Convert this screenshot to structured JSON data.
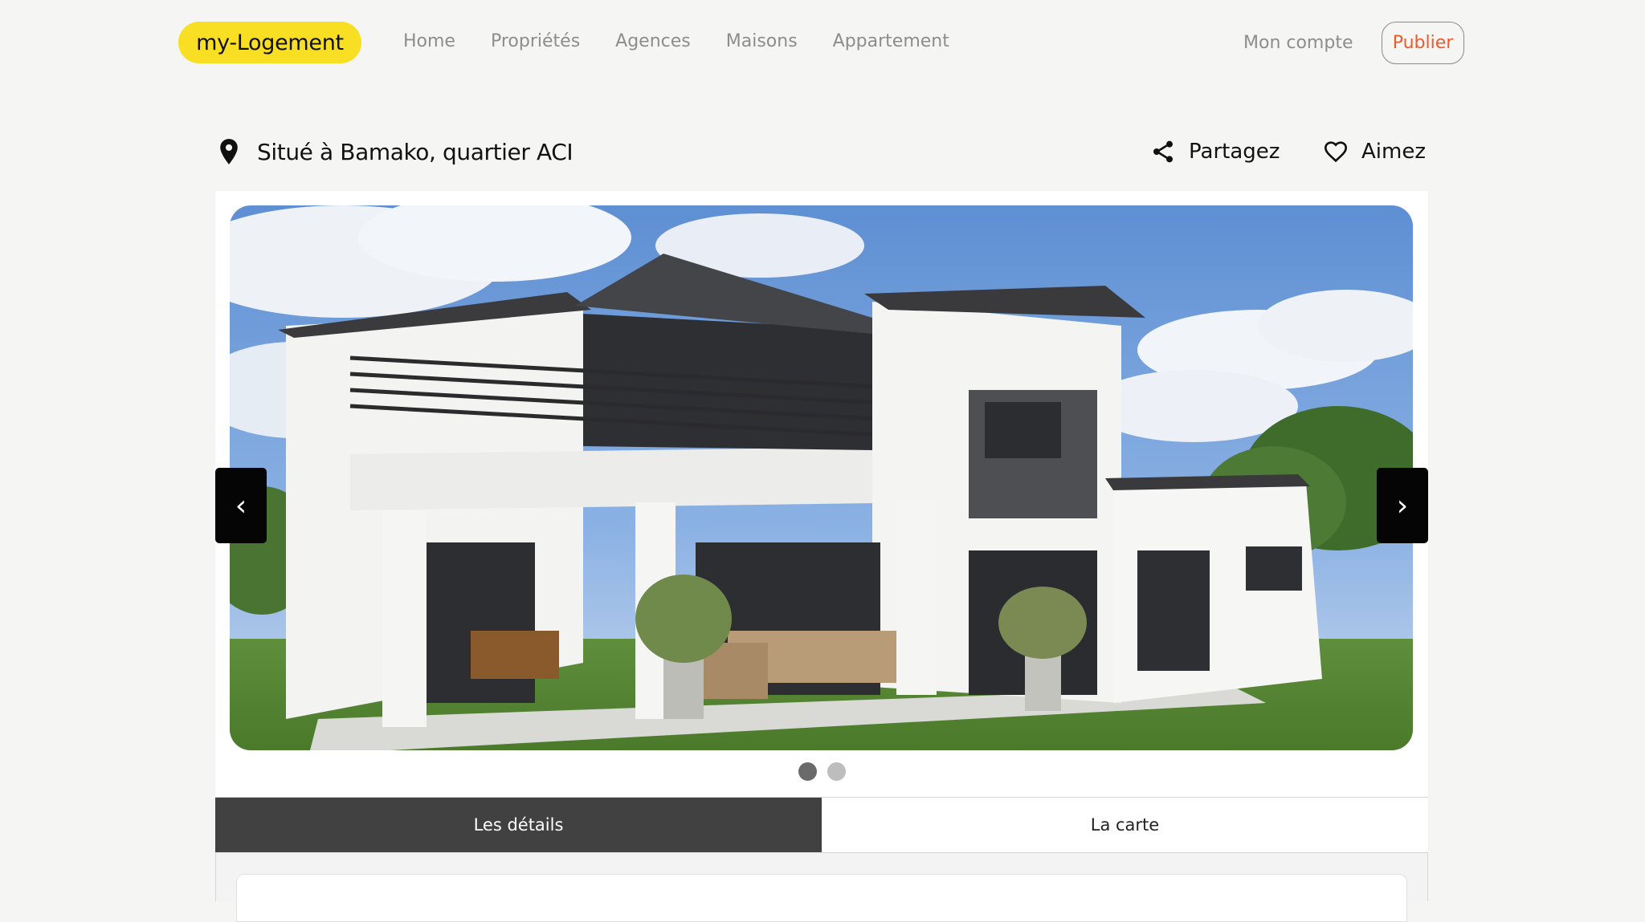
{
  "header": {
    "logo": "my-Logement",
    "nav": [
      {
        "label": "Home"
      },
      {
        "label": "Propriétés"
      },
      {
        "label": "Agences"
      },
      {
        "label": "Maisons"
      },
      {
        "label": "Appartement"
      }
    ],
    "account_label": "Mon compte",
    "publish_label": "Publier"
  },
  "listing": {
    "location": "Situé à Bamako, quartier ACI",
    "share_label": "Partagez",
    "like_label": "Aimez"
  },
  "carousel": {
    "prev": "‹",
    "next": "›",
    "slides_count": 2,
    "active_slide": 1
  },
  "tabs": [
    {
      "label": "Les détails",
      "active": true
    },
    {
      "label": "La carte",
      "active": false
    }
  ],
  "colors": {
    "brand_yellow": "#f8df24",
    "publish_accent": "#ee5a2c",
    "tab_active": "#414141"
  }
}
